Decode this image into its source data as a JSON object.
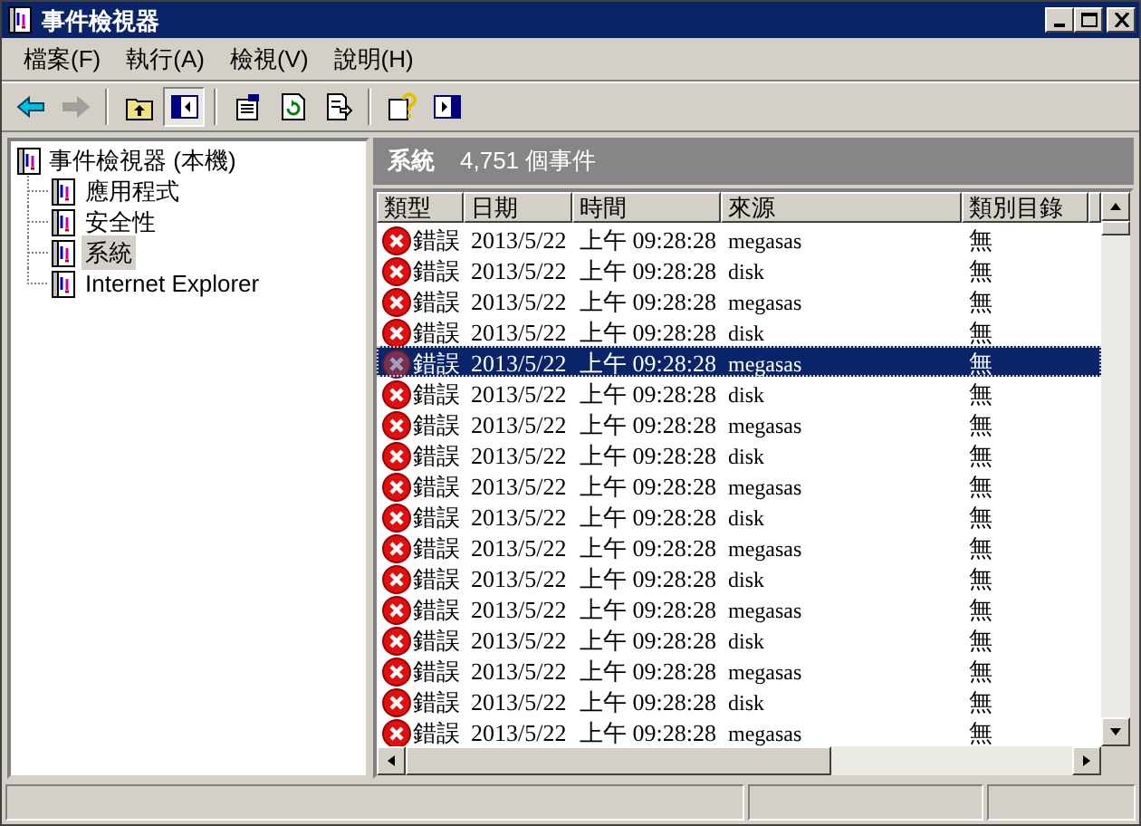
{
  "window": {
    "title": "事件檢視器"
  },
  "menu": [
    {
      "label": "檔案(F)"
    },
    {
      "label": "執行(A)"
    },
    {
      "label": "檢視(V)"
    },
    {
      "label": "說明(H)"
    }
  ],
  "toolbar": [
    {
      "kind": "back",
      "disabled": false,
      "pressed": false
    },
    {
      "kind": "forward",
      "disabled": true,
      "pressed": false
    },
    {
      "kind": "separator"
    },
    {
      "kind": "up",
      "disabled": false,
      "pressed": false
    },
    {
      "kind": "tree",
      "disabled": false,
      "pressed": true
    },
    {
      "kind": "separator"
    },
    {
      "kind": "properties",
      "disabled": false,
      "pressed": false
    },
    {
      "kind": "refresh",
      "disabled": false,
      "pressed": false
    },
    {
      "kind": "export",
      "disabled": false,
      "pressed": false
    },
    {
      "kind": "separator"
    },
    {
      "kind": "help",
      "disabled": false,
      "pressed": false
    },
    {
      "kind": "panel",
      "disabled": false,
      "pressed": false
    }
  ],
  "tree": {
    "label": "事件檢視器 (本機)",
    "children": [
      {
        "label": "應用程式",
        "selected": false
      },
      {
        "label": "安全性",
        "selected": false
      },
      {
        "label": "系統",
        "selected": true
      },
      {
        "label": "Internet Explorer",
        "selected": false
      }
    ]
  },
  "panel": {
    "title": "系統",
    "count": "4,751 個事件"
  },
  "table": {
    "columns": [
      "類型",
      "日期",
      "時間",
      "來源",
      "類別目錄"
    ],
    "rows": [
      {
        "type": "錯誤",
        "date": "2013/5/22",
        "time": "上午 09:28:28",
        "source": "megasas",
        "category": "無",
        "selected": false
      },
      {
        "type": "錯誤",
        "date": "2013/5/22",
        "time": "上午 09:28:28",
        "source": "disk",
        "category": "無",
        "selected": false
      },
      {
        "type": "錯誤",
        "date": "2013/5/22",
        "time": "上午 09:28:28",
        "source": "megasas",
        "category": "無",
        "selected": false
      },
      {
        "type": "錯誤",
        "date": "2013/5/22",
        "time": "上午 09:28:28",
        "source": "disk",
        "category": "無",
        "selected": false
      },
      {
        "type": "錯誤",
        "date": "2013/5/22",
        "time": "上午 09:28:28",
        "source": "megasas",
        "category": "無",
        "selected": true
      },
      {
        "type": "錯誤",
        "date": "2013/5/22",
        "time": "上午 09:28:28",
        "source": "disk",
        "category": "無",
        "selected": false
      },
      {
        "type": "錯誤",
        "date": "2013/5/22",
        "time": "上午 09:28:28",
        "source": "megasas",
        "category": "無",
        "selected": false
      },
      {
        "type": "錯誤",
        "date": "2013/5/22",
        "time": "上午 09:28:28",
        "source": "disk",
        "category": "無",
        "selected": false
      },
      {
        "type": "錯誤",
        "date": "2013/5/22",
        "time": "上午 09:28:28",
        "source": "megasas",
        "category": "無",
        "selected": false
      },
      {
        "type": "錯誤",
        "date": "2013/5/22",
        "time": "上午 09:28:28",
        "source": "disk",
        "category": "無",
        "selected": false
      },
      {
        "type": "錯誤",
        "date": "2013/5/22",
        "time": "上午 09:28:28",
        "source": "megasas",
        "category": "無",
        "selected": false
      },
      {
        "type": "錯誤",
        "date": "2013/5/22",
        "time": "上午 09:28:28",
        "source": "disk",
        "category": "無",
        "selected": false
      },
      {
        "type": "錯誤",
        "date": "2013/5/22",
        "time": "上午 09:28:28",
        "source": "megasas",
        "category": "無",
        "selected": false
      },
      {
        "type": "錯誤",
        "date": "2013/5/22",
        "time": "上午 09:28:28",
        "source": "disk",
        "category": "無",
        "selected": false
      },
      {
        "type": "錯誤",
        "date": "2013/5/22",
        "time": "上午 09:28:28",
        "source": "megasas",
        "category": "無",
        "selected": false
      },
      {
        "type": "錯誤",
        "date": "2013/5/22",
        "time": "上午 09:28:28",
        "source": "disk",
        "category": "無",
        "selected": false
      },
      {
        "type": "錯誤",
        "date": "2013/5/22",
        "time": "上午 09:28:28",
        "source": "megasas",
        "category": "無",
        "selected": false
      }
    ]
  }
}
